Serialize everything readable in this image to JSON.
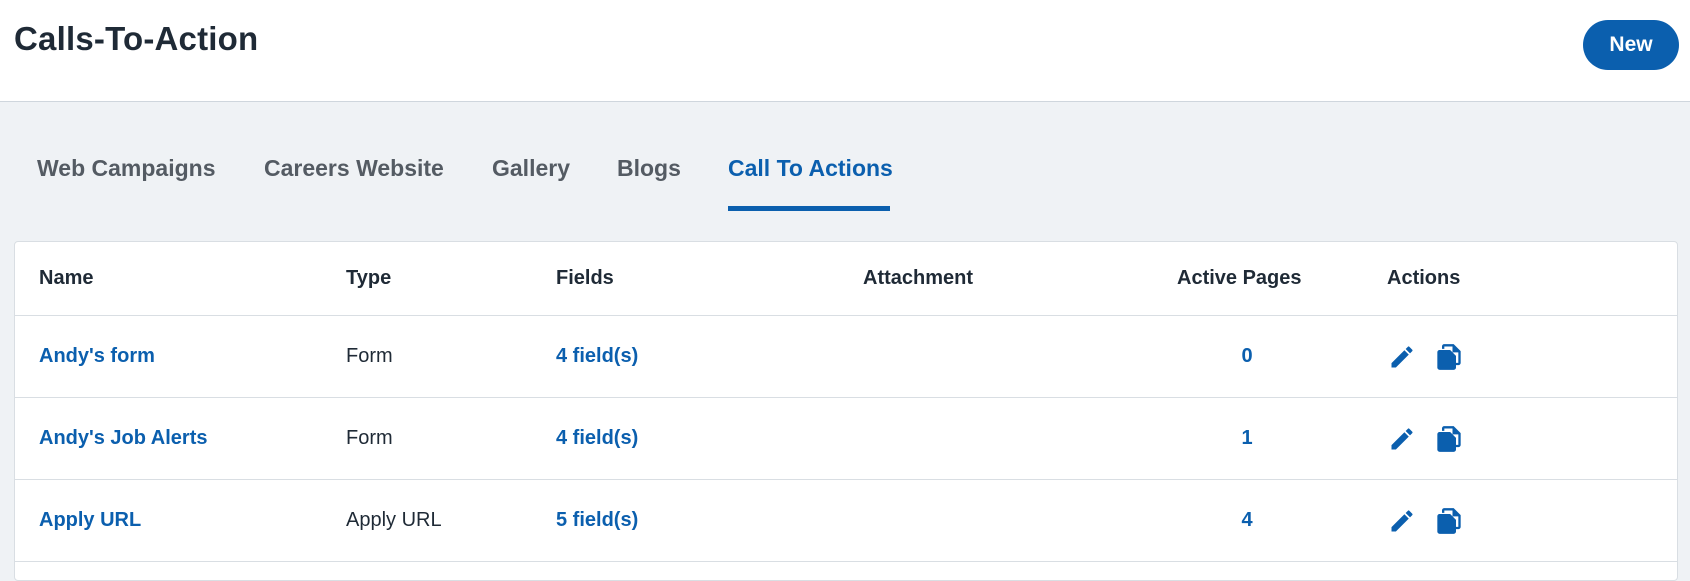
{
  "header": {
    "title": "Calls-To-Action",
    "new_label": "New"
  },
  "tabs": [
    {
      "label": "Web Campaigns",
      "active": false
    },
    {
      "label": "Careers Website",
      "active": false
    },
    {
      "label": "Gallery",
      "active": false
    },
    {
      "label": "Blogs",
      "active": false
    },
    {
      "label": "Call To Actions",
      "active": true
    }
  ],
  "table": {
    "columns": [
      "Name",
      "Type",
      "Fields",
      "Attachment",
      "Active Pages",
      "Actions"
    ],
    "rows": [
      {
        "name": "Andy's form",
        "type": "Form",
        "fields": "4 field(s)",
        "attachment": "",
        "active_pages": "0"
      },
      {
        "name": "Andy's Job Alerts",
        "type": "Form",
        "fields": "4 field(s)",
        "attachment": "",
        "active_pages": "1"
      },
      {
        "name": "Apply URL",
        "type": "Apply URL",
        "fields": "5 field(s)",
        "attachment": "",
        "active_pages": "4"
      }
    ],
    "action_icons": [
      "pencil-icon",
      "copy-icon"
    ]
  },
  "colors": {
    "accent": "#0b5fae",
    "background": "#eff2f5",
    "text": "#1f2a36"
  }
}
